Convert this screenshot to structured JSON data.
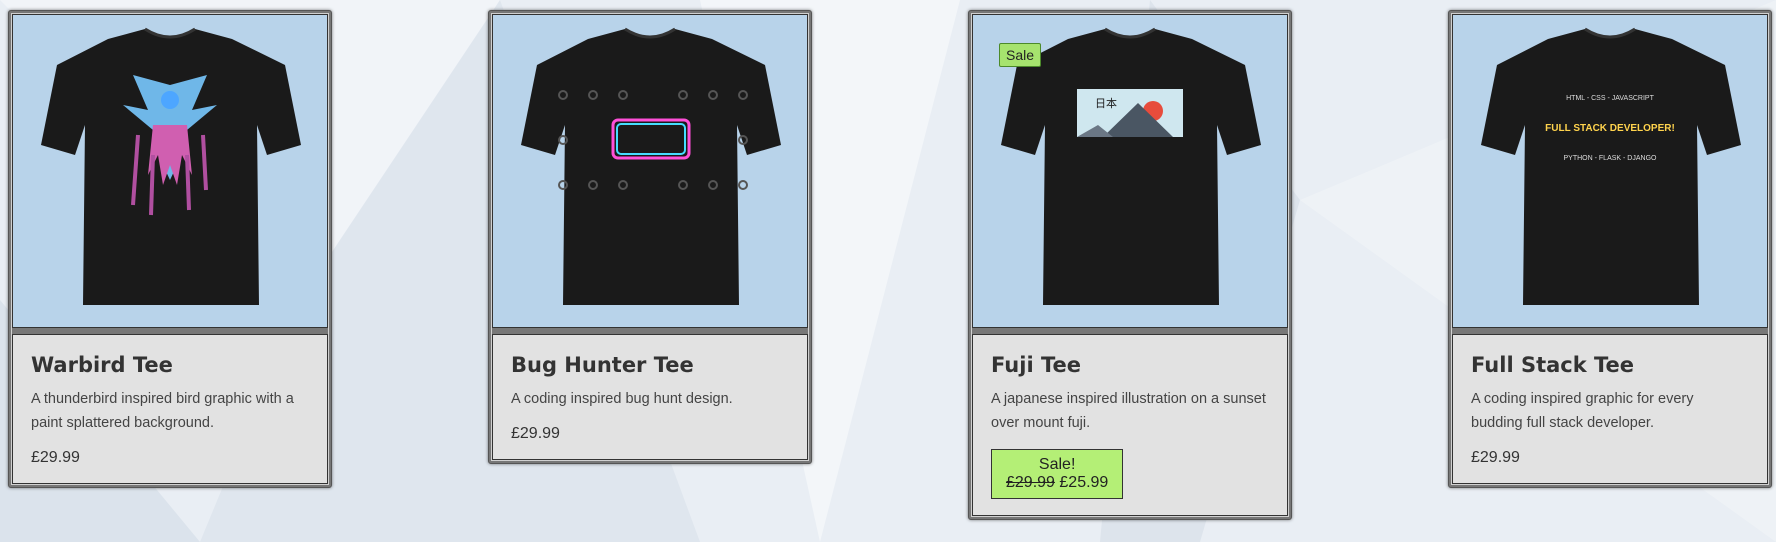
{
  "products": [
    {
      "title": "Warbird Tee",
      "desc": "A thunderbird inspired bird graphic with a paint splattered background.",
      "price": "£29.99",
      "graphic": "warbird-graphic",
      "color": "#b8d3ea"
    },
    {
      "title": "Bug Hunter Tee",
      "desc": "A coding inspired bug hunt design.",
      "price": "£29.99",
      "graphic": "bug-hunter-graphic"
    },
    {
      "title": "Fuji Tee",
      "desc": "A japanese inspired illustration on a sunset over mount fuji.",
      "sale_tag": "Sale",
      "sale_label": "Sale!",
      "old_price": "£29.99",
      "new_price": "£25.99",
      "graphic": "fuji-graphic",
      "graphic_text": "日本"
    },
    {
      "title": "Full Stack Tee",
      "desc": "A coding inspired graphic for every budding full stack developer.",
      "price": "£29.99",
      "graphic": "full-stack-graphic",
      "graphic_text_top": "HTML - CSS - JAVASCRIPT",
      "graphic_text_main": "FULL STACK DEVELOPER!",
      "graphic_text_bottom": "PYTHON - FLASK - DJANGO"
    }
  ],
  "colors": {
    "card_bg": "#e2e2e2",
    "image_bg": "#b8d3ea",
    "sale_green": "#b4ef76"
  }
}
